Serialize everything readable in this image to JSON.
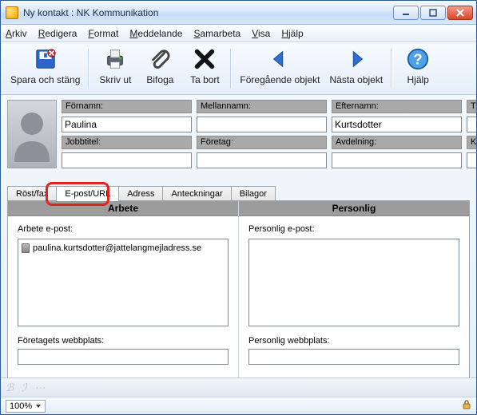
{
  "window": {
    "title": "Ny kontakt : NK Kommunikation"
  },
  "menu": {
    "arkiv": "Arkiv",
    "redigera": "Redigera",
    "format": "Format",
    "meddelande": "Meddelande",
    "samarbeta": "Samarbeta",
    "visa": "Visa",
    "hjalp": "Hjälp"
  },
  "toolbar": {
    "save_close": "Spara och stäng",
    "print": "Skriv ut",
    "attach": "Bifoga",
    "delete": "Ta bort",
    "prev": "Föregående objekt",
    "next": "Nästa objekt",
    "help": "Hjälp"
  },
  "fields": {
    "fornamn_label": "Förnamn:",
    "fornamn_value": "Paulina",
    "mellannamn_label": "Mellannamn:",
    "mellannamn_value": "",
    "efternamn_label": "Efternamn:",
    "efternamn_value": "Kurtsdotter",
    "titel_label": "Titel:",
    "titel_value": "",
    "jobbtitel_label": "Jobbtitel:",
    "jobbtitel_value": "",
    "foretag_label": "Företag:",
    "foretag_value": "",
    "avdelning_label": "Avdelning:",
    "avdelning_value": "",
    "kontor_label": "Kontor:",
    "kontor_value": ""
  },
  "tabs": {
    "rost": "Röst/fax",
    "epost": "E-post/URL",
    "adress": "Adress",
    "anteckningar": "Anteckningar",
    "bilagor": "Bilagor"
  },
  "panel": {
    "work_header": "Arbete",
    "personal_header": "Personlig",
    "work_email_label": "Arbete e-post:",
    "work_email_value": "paulina.kurtsdotter@jattelangmejladress.se",
    "work_web_label": "Företagets webbplats:",
    "work_web_value": "",
    "personal_email_label": "Personlig e-post:",
    "personal_web_label": "Personlig webbplats:",
    "personal_web_value": ""
  },
  "status": {
    "zoom": "100%"
  }
}
